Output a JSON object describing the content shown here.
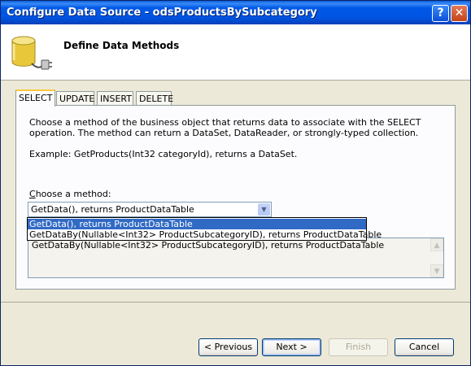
{
  "window": {
    "title": "Configure Data Source - odsProductsBySubcategory",
    "help_glyph": "?",
    "close_glyph": "✕"
  },
  "header": {
    "title": "Define Data Methods",
    "icon": "database-plug-icon"
  },
  "tabs": [
    "SELECT",
    "UPDATE",
    "INSERT",
    "DELETE"
  ],
  "active_tab": "SELECT",
  "panel": {
    "description": "Choose a method of the business object that returns data to associate with the SELECT operation. The method can return a DataSet, DataReader, or strongly-typed collection.",
    "example": "Example: GetProducts(Int32 categoryId), returns a DataSet.",
    "choose_label": "Choose a method:",
    "selected_method": "GetData(), returns ProductDataTable",
    "method_options": [
      "GetData(), returns ProductDataTable",
      "GetDataBy(Nullable<Int32> ProductSubcategoryID), returns ProductDataTable"
    ],
    "highlighted_option": "GetData(), returns ProductDataTable",
    "method_signature": "GetDataBy(Nullable<Int32> ProductSubcategoryID), returns ProductDataTable"
  },
  "buttons": {
    "previous": "< Previous",
    "next": "Next >",
    "finish": "Finish",
    "cancel": "Cancel"
  },
  "colors": {
    "titlebar": "#0054e3",
    "selection": "#316ac5",
    "tab_highlight": "#ffc83c"
  }
}
